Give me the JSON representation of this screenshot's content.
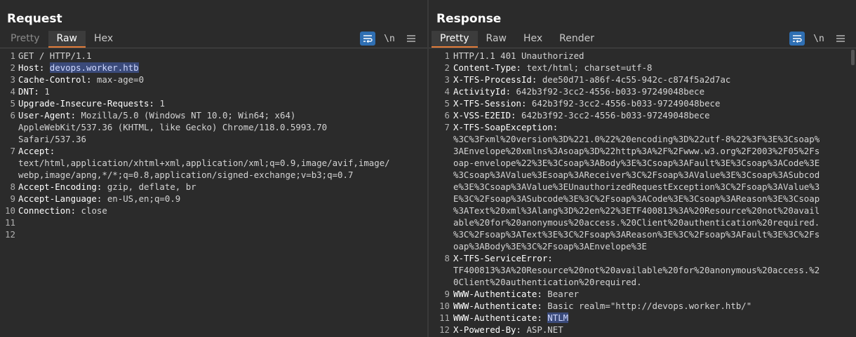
{
  "request": {
    "title": "Request",
    "tabs": [
      "Pretty",
      "Raw",
      "Hex"
    ],
    "active_tab": "Raw",
    "newline_label": "\\n",
    "lines": [
      {
        "n": "1",
        "name": "",
        "value": "GET / HTTP/1.1"
      },
      {
        "n": "2",
        "name": "Host:",
        "value": "devops.worker.htb",
        "highlight": true
      },
      {
        "n": "3",
        "name": "Cache-Control:",
        "value": "max-age=0"
      },
      {
        "n": "4",
        "name": "DNT:",
        "value": "1"
      },
      {
        "n": "5",
        "name": "Upgrade-Insecure-Requests:",
        "value": "1"
      },
      {
        "n": "6",
        "name": "User-Agent:",
        "value": "Mozilla/5.0 (Windows NT 10.0; Win64; x64)\nAppleWebKit/537.36 (KHTML, like Gecko) Chrome/118.0.5993.70\nSafari/537.36"
      },
      {
        "n": "7",
        "name": "Accept:",
        "value": "\ntext/html,application/xhtml+xml,application/xml;q=0.9,image/avif,image/\nwebp,image/apng,*/*;q=0.8,application/signed-exchange;v=b3;q=0.7"
      },
      {
        "n": "8",
        "name": "Accept-Encoding:",
        "value": "gzip, deflate, br"
      },
      {
        "n": "9",
        "name": "Accept-Language:",
        "value": "en-US,en;q=0.9"
      },
      {
        "n": "10",
        "name": "Connection:",
        "value": "close"
      },
      {
        "n": "11",
        "name": "",
        "value": ""
      },
      {
        "n": "12",
        "name": "",
        "value": ""
      }
    ]
  },
  "response": {
    "title": "Response",
    "tabs": [
      "Pretty",
      "Raw",
      "Hex",
      "Render"
    ],
    "active_tab": "Pretty",
    "newline_label": "\\n",
    "lines": [
      {
        "n": "1",
        "name": "",
        "value": "HTTP/1.1 401 Unauthorized"
      },
      {
        "n": "2",
        "name": "Content-Type:",
        "value": "text/html; charset=utf-8"
      },
      {
        "n": "3",
        "name": "X-TFS-ProcessId:",
        "value": "dee50d71-a86f-4c55-942c-c874f5a2d7ac"
      },
      {
        "n": "4",
        "name": "ActivityId:",
        "value": "642b3f92-3cc2-4556-b033-97249048bece"
      },
      {
        "n": "5",
        "name": "X-TFS-Session:",
        "value": "642b3f92-3cc2-4556-b033-97249048bece"
      },
      {
        "n": "6",
        "name": "X-VSS-E2EID:",
        "value": "642b3f92-3cc2-4556-b033-97249048bece"
      },
      {
        "n": "7",
        "name": "X-TFS-SoapException:",
        "value": "\n%3C%3Fxml%20version%3D%221.0%22%20encoding%3D%22utf-8%22%3F%3E%3Csoap%\n3AEnvelope%20xmlns%3Asoap%3D%22http%3A%2F%2Fwww.w3.org%2F2003%2F05%2Fs\noap-envelope%22%3E%3Csoap%3ABody%3E%3Csoap%3AFault%3E%3Csoap%3ACode%3E\n%3Csoap%3AValue%3Esoap%3AReceiver%3C%2Fsoap%3AValue%3E%3Csoap%3ASubcod\ne%3E%3Csoap%3AValue%3EUnauthorizedRequestException%3C%2Fsoap%3AValue%3\nE%3C%2Fsoap%3ASubcode%3E%3C%2Fsoap%3ACode%3E%3Csoap%3AReason%3E%3Csoap\n%3AText%20xml%3Alang%3D%22en%22%3ETF400813%3A%20Resource%20not%20avail\nable%20for%20anonymous%20access.%20Client%20authentication%20required.\n%3C%2Fsoap%3AText%3E%3C%2Fsoap%3AReason%3E%3C%2Fsoap%3AFault%3E%3C%2Fs\noap%3ABody%3E%3C%2Fsoap%3AEnvelope%3E"
      },
      {
        "n": "8",
        "name": "X-TFS-ServiceError:",
        "value": "\nTF400813%3A%20Resource%20not%20available%20for%20anonymous%20access.%2\n0Client%20authentication%20required."
      },
      {
        "n": "9",
        "name": "WWW-Authenticate:",
        "value": "Bearer"
      },
      {
        "n": "10",
        "name": "WWW-Authenticate:",
        "value": "Basic realm=\"http://devops.worker.htb/\""
      },
      {
        "n": "11",
        "name": "WWW-Authenticate:",
        "value": "NTLM",
        "highlight": true
      },
      {
        "n": "12",
        "name": "X-Powered-By:",
        "value": "ASP.NET"
      }
    ]
  },
  "icons": {
    "wrap": "word-wrap-icon",
    "menu": "hamburger-menu-icon",
    "layout": [
      "split-horizontal-icon",
      "split-vertical-icon",
      "single-pane-icon"
    ]
  },
  "colors": {
    "accent": "#2f6fb3",
    "tab_underline": "#e07b39",
    "highlight": "#3a4a7a"
  }
}
